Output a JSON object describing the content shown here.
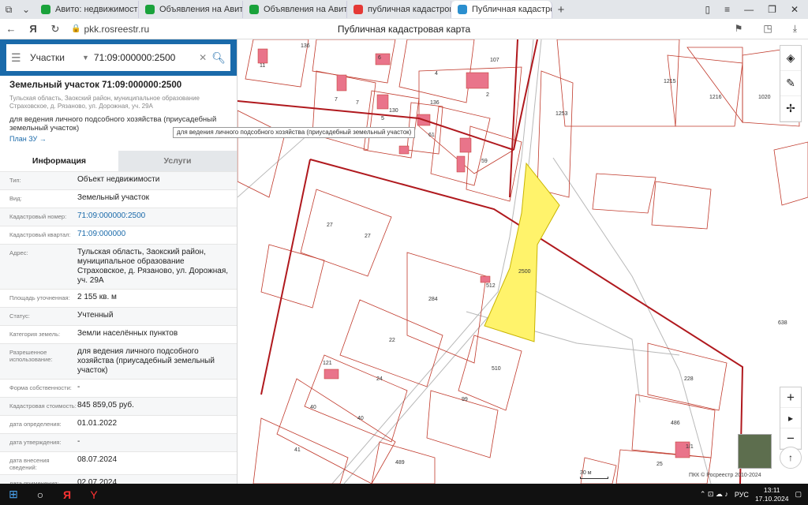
{
  "browser": {
    "tabs": [
      {
        "title": "Авито: недвижимость, тр",
        "color": "#1aa23b"
      },
      {
        "title": "Объявления на Авито Ре",
        "color": "#1aa23b"
      },
      {
        "title": "Объявления на Авито Ре",
        "color": "#1aa23b"
      },
      {
        "title": "публичная кадастровая",
        "color": "#e53935"
      },
      {
        "title": "Публичная кадастровая",
        "color": "#2b8fcf"
      }
    ],
    "url": "pkk.rosreestr.ru",
    "page_title": "Публичная кадастровая карта"
  },
  "search": {
    "type": "Участки",
    "query": "71:09:000000:2500"
  },
  "object": {
    "title": "Земельный участок 71:09:000000:2500",
    "address_short": "Тульская область, Заокский район, муниципальное образование Страховское, д. Рязаново, ул. Дорожная, уч. 29А",
    "use": "для ведения личного подсобного хозяйства (приусадебный земельный участок)",
    "plan_link": "План ЗУ →",
    "tooltip": "для ведения личного подсобного хозяйства (приусадебный земельный участок)"
  },
  "info_tabs": [
    "Информация",
    "Услуги"
  ],
  "rows": [
    {
      "label": "Тип:",
      "value": "Объект недвижимости"
    },
    {
      "label": "Вид:",
      "value": "Земельный участок"
    },
    {
      "label": "Кадастровый номер:",
      "value": "71:09:000000:2500"
    },
    {
      "label": "Кадастровый квартал:",
      "value": "71:09:000000"
    },
    {
      "label": "Адрес:",
      "value": "Тульская область, Заокский район, муниципальное образование Страховское, д. Рязаново, ул. Дорожная, уч. 29А"
    },
    {
      "label": "Площадь уточненная:",
      "value": "2 155 кв. м"
    },
    {
      "label": "Статус:",
      "value": "Учтенный"
    },
    {
      "label": "Категория земель:",
      "value": "Земли населённых пунктов"
    },
    {
      "label": "Разрешенное использование:",
      "value": "для ведения личного подсобного хозяйства (приусадебный земельный участок)"
    },
    {
      "label": "Форма собственности:",
      "value": "-"
    },
    {
      "label": "Кадастровая стоимость:",
      "value": "845 859,05 руб."
    },
    {
      "label": "дата определения:",
      "value": "01.01.2022"
    },
    {
      "label": "дата утверждения:",
      "value": "-"
    },
    {
      "label": "дата внесения сведений:",
      "value": "08.07.2024"
    },
    {
      "label": "дата применения:",
      "value": "02.07.2024"
    }
  ],
  "map": {
    "labels": [
      "136",
      "11",
      "6",
      "107",
      "4",
      "2",
      "1215",
      "1216",
      "1020",
      "7",
      "7",
      "5",
      "136",
      "61",
      "1253",
      "59",
      "27",
      "27",
      "2500",
      "284",
      "638",
      "22",
      "121",
      "24",
      "510",
      "228",
      "40",
      "40",
      "99",
      "486",
      "41",
      "489",
      "25",
      "1/1",
      "130",
      "512"
    ],
    "selected_color": "#fff36b",
    "scale": "30 м",
    "copyright": "ПКК © Росреестр 2010-2024"
  },
  "taskbar": {
    "lang": "РУС",
    "time": "13:11",
    "date": "17.10.2024"
  }
}
